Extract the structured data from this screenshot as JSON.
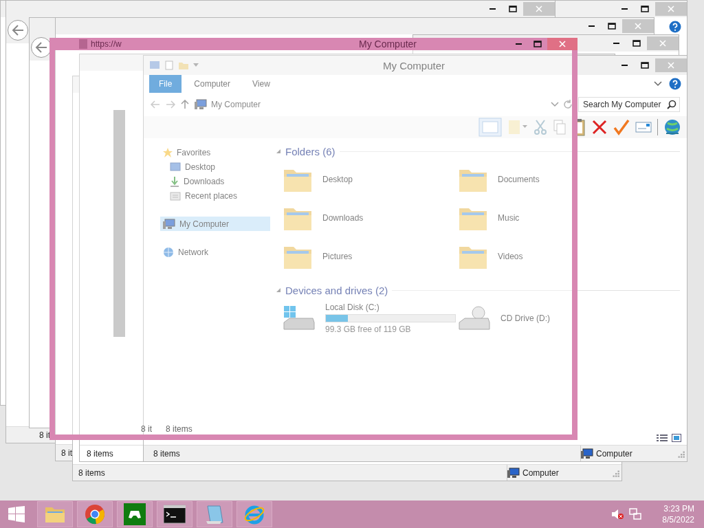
{
  "desktop_windows": [
    {
      "kind": "explorer",
      "status": "8 items"
    },
    {
      "kind": "explorer",
      "status": "8 items",
      "location": "Computer"
    },
    {
      "kind": "explorer"
    },
    {
      "kind": "explorer",
      "status": "8 it"
    },
    {
      "kind": "browser"
    },
    {
      "kind": "browser",
      "status": "8 it"
    },
    {
      "kind": "explorer",
      "help": true
    }
  ],
  "explorer": {
    "title": "My Computer",
    "ribbon_tabs": [
      {
        "label": "File",
        "selected": true
      },
      {
        "label": "Computer",
        "selected": false
      },
      {
        "label": "View",
        "selected": false
      }
    ],
    "address": "My Computer",
    "search": {
      "placeholder": "Search My Computer"
    },
    "sidebar": [
      {
        "label": "Favorites",
        "kind": "star",
        "selected": false,
        "children": [
          {
            "label": "Desktop",
            "kind": "desktop",
            "selected": false
          },
          {
            "label": "Downloads",
            "kind": "downloads",
            "selected": false
          },
          {
            "label": "Recent places",
            "kind": "recent",
            "selected": false
          }
        ]
      },
      {
        "label": "My Computer",
        "kind": "computer",
        "selected": true
      },
      {
        "label": "Network",
        "kind": "network",
        "selected": false
      }
    ],
    "groups": [
      {
        "title": "Folders (6)",
        "items": [
          {
            "label": "Desktop",
            "kind": "folder"
          },
          {
            "label": "Documents",
            "kind": "folder"
          },
          {
            "label": "Downloads",
            "kind": "folder"
          },
          {
            "label": "Music",
            "kind": "folder"
          },
          {
            "label": "Pictures",
            "kind": "folder"
          },
          {
            "label": "Videos",
            "kind": "folder"
          }
        ]
      },
      {
        "title": "Devices and drives (2)",
        "items": [
          {
            "label": "Local Disk (C:)",
            "kind": "disk",
            "level": 0.17,
            "detail": "99.3 GB free of 119 GB"
          },
          {
            "label": "CD Drive (D:)",
            "kind": "cd"
          }
        ]
      }
    ],
    "status": "8 items",
    "location": "Computer"
  },
  "ghost_window": {
    "title": "My Computer",
    "address": "https://w",
    "status_texts": [
      "8 it",
      "8 items"
    ]
  },
  "taskbar": {
    "apps": [
      {
        "kind": "explorer"
      },
      {
        "kind": "chrome"
      },
      {
        "kind": "game"
      },
      {
        "kind": "console"
      },
      {
        "kind": "notepad"
      },
      {
        "kind": "ie"
      }
    ],
    "time": "3:23 PM",
    "date": "8/5/2022"
  }
}
